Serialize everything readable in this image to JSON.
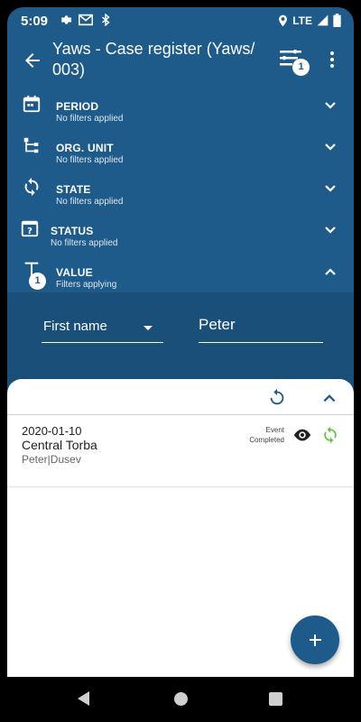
{
  "status_bar": {
    "time": "5:09",
    "network": "LTE",
    "left_icons": [
      "gear-icon",
      "gmail-icon",
      "bluetooth-icon"
    ],
    "right_icons": [
      "location-icon",
      "signal-icon",
      "battery-icon"
    ]
  },
  "toolbar": {
    "title_line1": "Yaws - Case register (Yaws/",
    "title_line2": "003)",
    "filter_badge": "1"
  },
  "filters": [
    {
      "label": "PERIOD",
      "status": "No filters applied",
      "icon": "calendar-icon",
      "expanded": false
    },
    {
      "label": "ORG. UNIT",
      "status": "No filters applied",
      "icon": "org-unit-tree-icon",
      "expanded": false
    },
    {
      "label": "STATE",
      "status": "No filters applied",
      "icon": "sync-icon",
      "expanded": false
    },
    {
      "label": "STATUS",
      "status": "No filters applied",
      "icon": "calendar-question-icon",
      "expanded": false
    },
    {
      "label": "VALUE",
      "status": "Filters applying",
      "icon": "text-t-icon",
      "expanded": true,
      "badge": "1"
    }
  ],
  "value_filter": {
    "attribute": "First name",
    "value": "Peter"
  },
  "events": [
    {
      "date": "2020-01-10",
      "org_unit": "Central Torba",
      "names": "Peter|Dusev",
      "status_line1": "Event",
      "status_line2": "Completed"
    }
  ],
  "colors": {
    "primary": "#1e5b8a",
    "value_panel": "#1a4f7a",
    "sync_green": "#5cc639"
  }
}
